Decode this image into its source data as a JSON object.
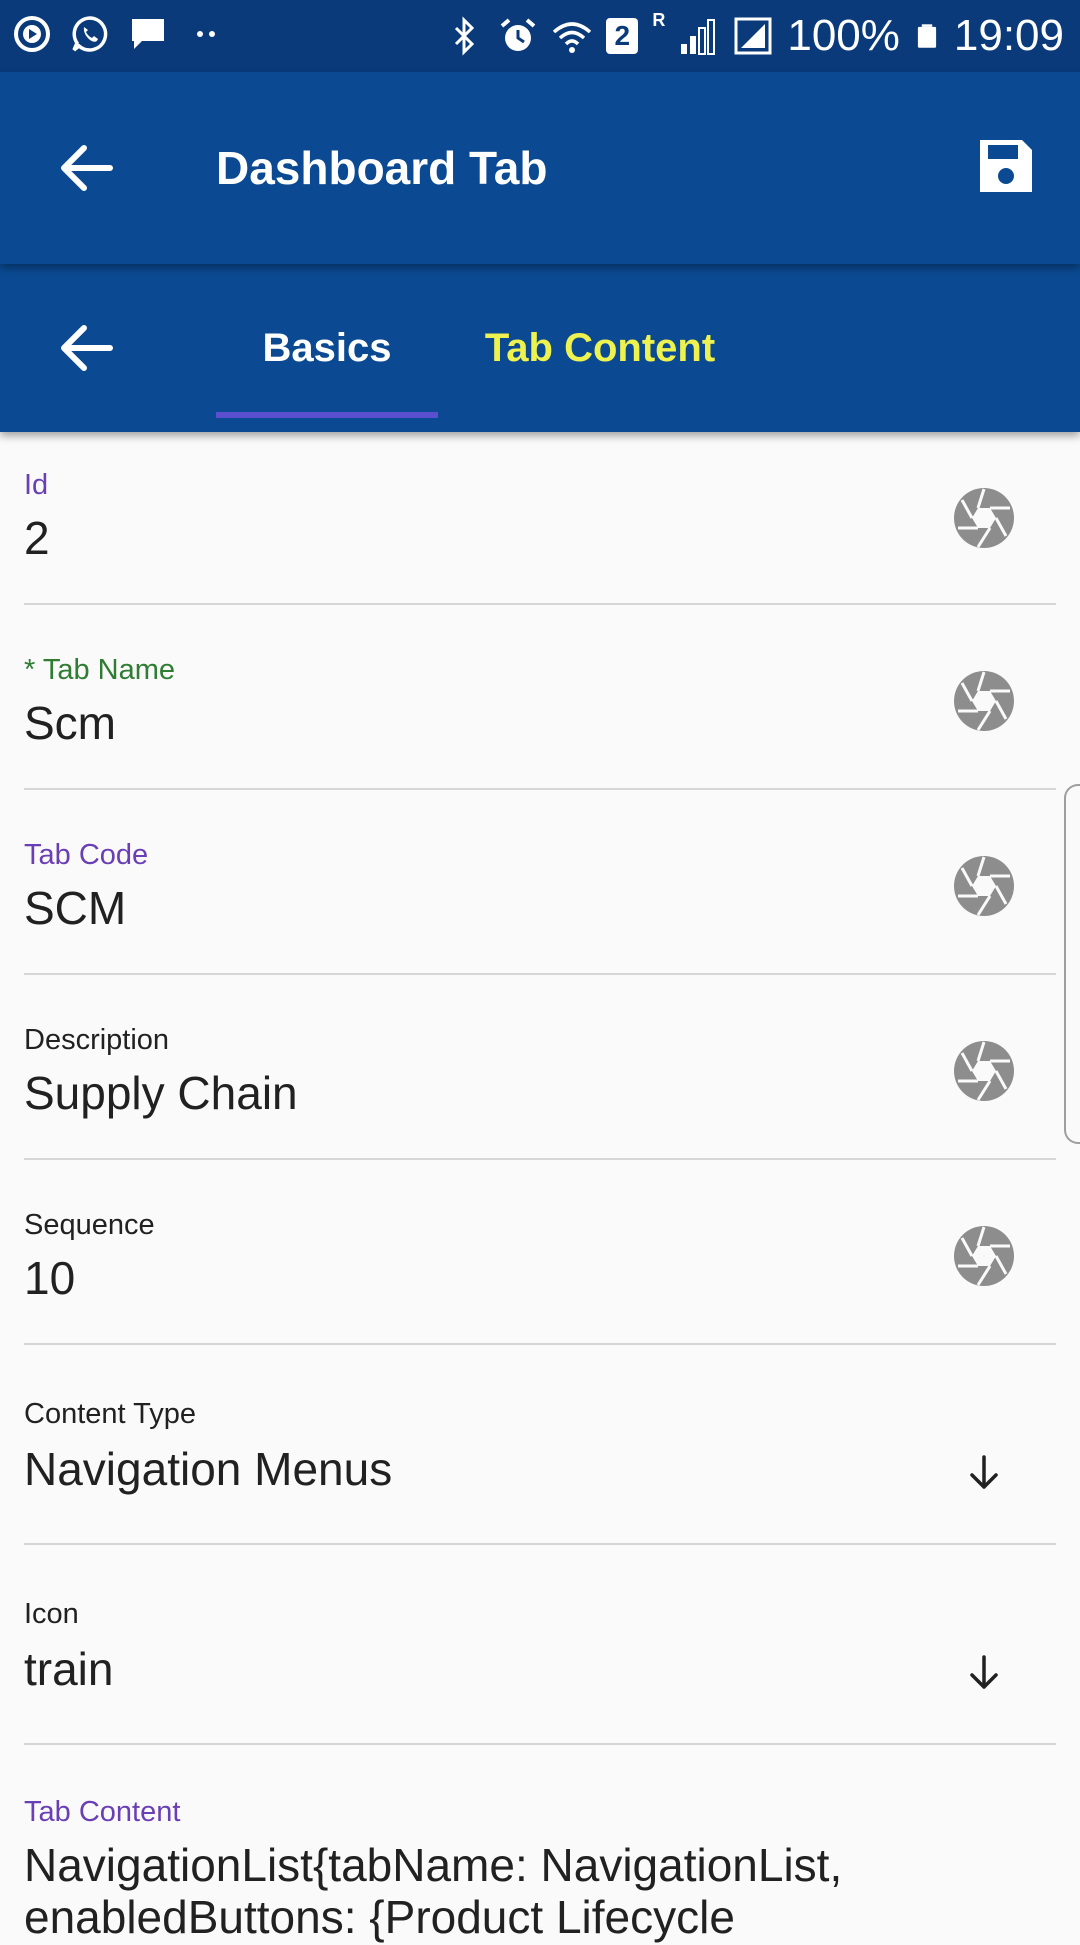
{
  "status_bar": {
    "battery": "100%",
    "time": "19:09",
    "sim_slot": "2",
    "roaming": "R"
  },
  "app_bar": {
    "title": "Dashboard Tab"
  },
  "tabs": [
    {
      "label": "Basics",
      "active": true
    },
    {
      "label": "Tab Content",
      "active": false
    }
  ],
  "form": {
    "id": {
      "label": "Id",
      "value": "2"
    },
    "tab_name": {
      "label": "* Tab Name",
      "value": "Scm"
    },
    "tab_code": {
      "label": "Tab Code",
      "value": "SCM"
    },
    "description": {
      "label": "Description",
      "value": "Supply Chain"
    },
    "sequence": {
      "label": "Sequence",
      "value": "10"
    },
    "content_type": {
      "label": "Content Type",
      "value": "Navigation Menus"
    },
    "icon": {
      "label": "Icon",
      "value": "train"
    },
    "tab_content": {
      "label": "Tab Content",
      "value": "NavigationList{tabName: NavigationList, enabledButtons: {Product Lifecycle"
    }
  },
  "colors": {
    "status_bar": "#0a3a7a",
    "app_bar": "#0b4a92",
    "active_tab_text": "#ffffff",
    "inactive_tab_text": "#eef24f",
    "tab_indicator": "#5a4fcf",
    "label_focus_purple": "#6a3fb5",
    "label_required_green": "#2e7d32"
  },
  "icons": {
    "back": "arrow-left-icon",
    "save": "floppy-disk-icon",
    "field_action": "camera-aperture-icon",
    "dropdown": "arrow-down-icon"
  }
}
